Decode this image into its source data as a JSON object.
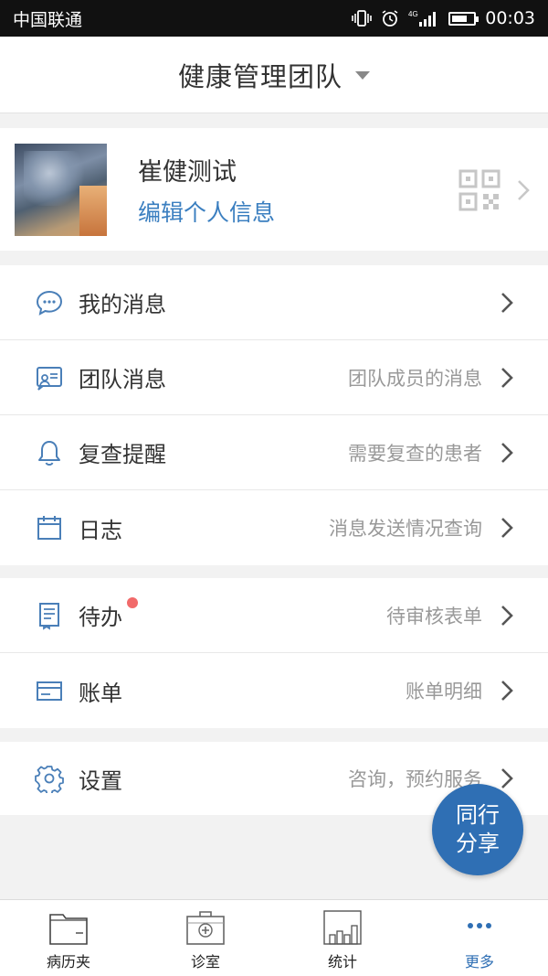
{
  "status_bar": {
    "carrier": "中国联通",
    "network": "4G",
    "time": "00:03"
  },
  "header": {
    "title": "健康管理团队"
  },
  "profile": {
    "name": "崔健测试",
    "edit_label": "编辑个人信息"
  },
  "menu_group_1": [
    {
      "label": "我的消息",
      "detail": "",
      "icon": "chat-bubble-icon"
    },
    {
      "label": "团队消息",
      "detail": "团队成员的消息",
      "icon": "team-message-icon"
    },
    {
      "label": "复查提醒",
      "detail": "需要复查的患者",
      "icon": "bell-icon"
    },
    {
      "label": "日志",
      "detail": "消息发送情况查询",
      "icon": "calendar-icon"
    }
  ],
  "menu_group_2": [
    {
      "label": "待办",
      "detail": "待审核表单",
      "icon": "todo-icon",
      "badge": true
    },
    {
      "label": "账单",
      "detail": "账单明细",
      "icon": "bill-card-icon"
    }
  ],
  "menu_group_3": [
    {
      "label": "设置",
      "detail": "咨询，预约服务",
      "icon": "gear-icon"
    }
  ],
  "fab": {
    "line1": "同行",
    "line2": "分享"
  },
  "tabs": [
    {
      "label": "病历夹",
      "icon": "folder-icon",
      "active": false
    },
    {
      "label": "诊室",
      "icon": "medical-kit-icon",
      "active": false
    },
    {
      "label": "统计",
      "icon": "bar-chart-icon",
      "active": false
    },
    {
      "label": "更多",
      "icon": "more-dots-icon",
      "active": true
    }
  ],
  "colors": {
    "accent": "#2f6fb4",
    "link": "#3b7fc0",
    "badge": "#f16a6a",
    "icon_blue": "#4a7fb8"
  }
}
